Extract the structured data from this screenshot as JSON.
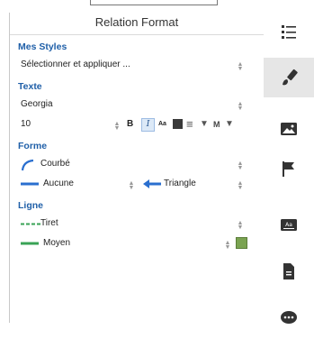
{
  "panel": {
    "title": "Relation Format"
  },
  "sections": {
    "styles": {
      "title": "Mes Styles",
      "select_value": "Sélectionner et appliquer ..."
    },
    "text": {
      "title": "Texte",
      "font": "Georgia",
      "size": "10",
      "bold_label": "B",
      "italic_label": "I",
      "case_label": "Aa",
      "align_glyph": "≡",
      "position_label": "M"
    },
    "shape": {
      "title": "Forme",
      "curve_label": "Courbé",
      "start_label": "Aucune",
      "end_label": "Triangle"
    },
    "line": {
      "title": "Ligne",
      "style_label": "Tiret",
      "width_label": "Moyen"
    }
  },
  "colors": {
    "accent": "#1f5fa8",
    "line_blue": "#2a6fcf",
    "line_green": "#3aa356",
    "fill_green": "#7aa351"
  },
  "sidebar": {
    "items": [
      {
        "icon": "list-format-icon",
        "active": false
      },
      {
        "icon": "paint-brush-icon",
        "active": true
      },
      {
        "icon": "image-icon",
        "active": false
      },
      {
        "icon": "flag-icon",
        "active": false
      },
      {
        "icon": "text-label-icon",
        "active": false
      },
      {
        "icon": "document-icon",
        "active": false
      },
      {
        "icon": "comment-icon",
        "active": false
      }
    ]
  }
}
